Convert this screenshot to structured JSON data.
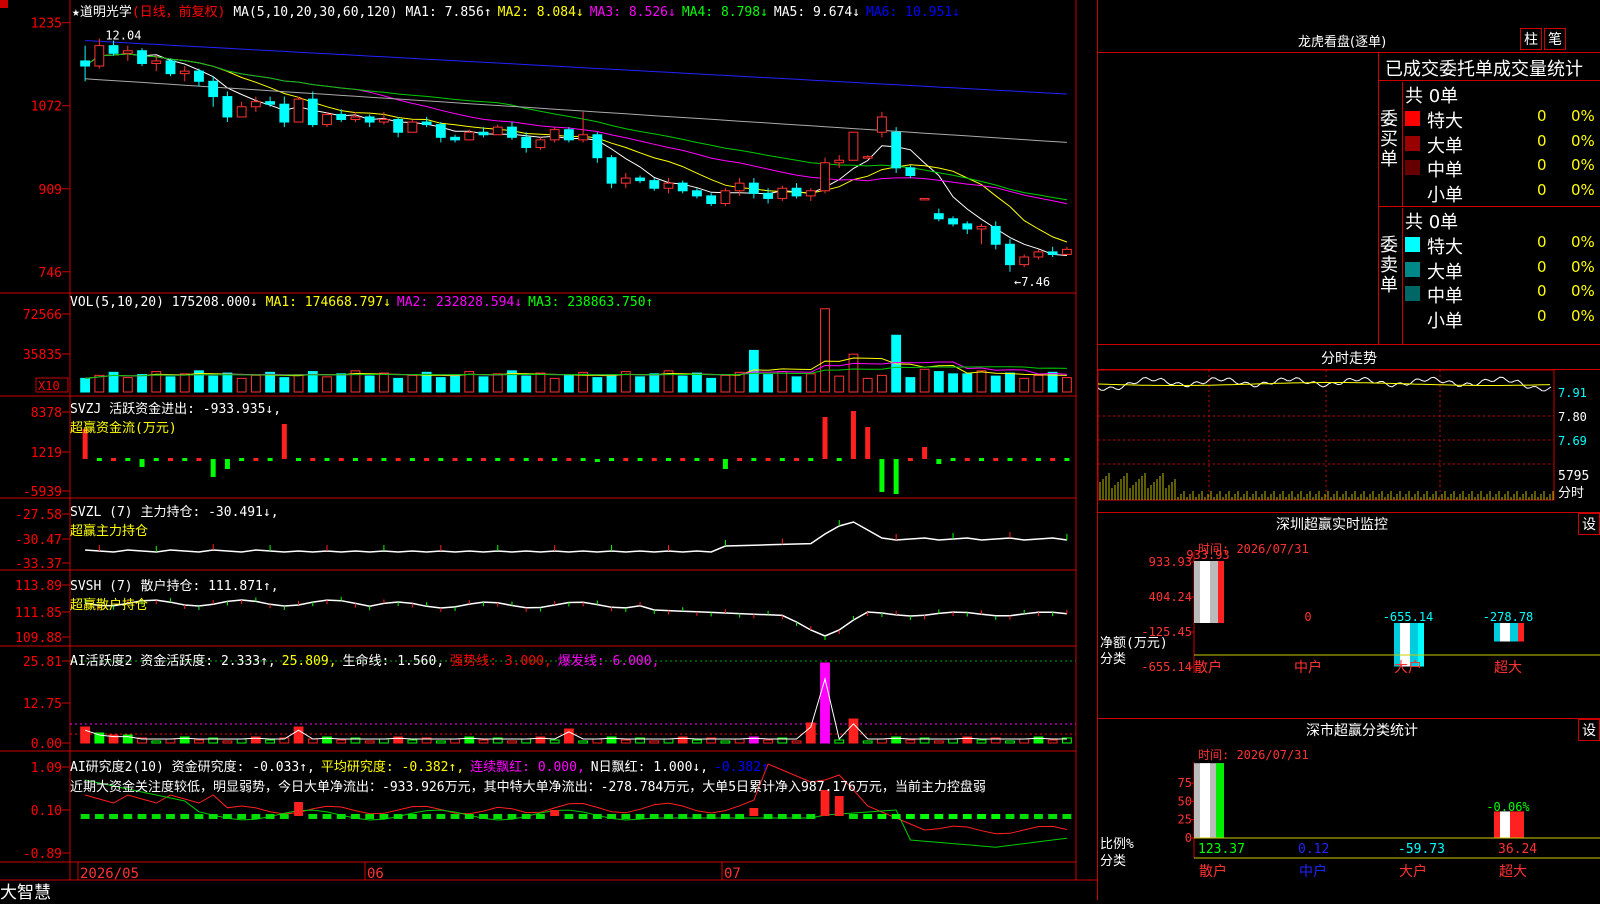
{
  "app_name": "大智慧",
  "stock": {
    "star": "★",
    "name": "道明光学",
    "period": "(日线，前复权)"
  },
  "ma_line": {
    "label": "MA(5,10,20,30,60,120)",
    "items": [
      {
        "text": "MA1: 7.856↑",
        "color": "#ffffff"
      },
      {
        "text": "MA2: 8.084↓",
        "color": "#ffff00"
      },
      {
        "text": "MA3: 8.526↓",
        "color": "#ff00ff"
      },
      {
        "text": "MA4: 8.798↓",
        "color": "#00ff00"
      },
      {
        "text": "MA5: 9.674↓",
        "color": "#ffffff"
      },
      {
        "text": "MA6: 10.951↓",
        "color": "#0000ff"
      }
    ]
  },
  "price_axis": [
    "1235",
    "1072",
    "909",
    "746"
  ],
  "price_marks": {
    "high": "12.04",
    "low": "←7.46"
  },
  "vol_line": {
    "label": "VOL(5,10,20)",
    "value": "175208.000↓",
    "items": [
      {
        "text": "MA1: 174668.797↓",
        "color": "#ffff00"
      },
      {
        "text": "MA2: 232828.594↓",
        "color": "#ff00ff"
      },
      {
        "text": "MA3: 238863.750↑",
        "color": "#00ff00"
      }
    ]
  },
  "vol_axis": [
    "72566",
    "35835"
  ],
  "vol_unit": "X10",
  "svzj": {
    "label": "SVZJ  活跃资金进出: -933.935↓,",
    "sub": "超赢资金流(万元)",
    "axis": [
      "8378",
      "1219",
      "-5939"
    ]
  },
  "svzl": {
    "label": "SVZL (7) 主力持仓: -30.491↓,",
    "sub": "超赢主力持仓",
    "axis": [
      "-27.58",
      "-30.47",
      "-33.37"
    ]
  },
  "svsh": {
    "label": "SVSH (7) 散户持仓: 111.871↑,",
    "sub": "超赢散户持仓",
    "axis": [
      "113.89",
      "111.85",
      "109.88"
    ]
  },
  "ai1": {
    "items": [
      {
        "text": "AI活跃度2 资金活跃度: 2.333↑,",
        "color": "#ffffff"
      },
      {
        "text": "25.809,",
        "color": "#ffff00"
      },
      {
        "text": "生命线: 1.560,",
        "color": "#ffffff"
      },
      {
        "text": "强势线: 3.000,",
        "color": "#ff0000"
      },
      {
        "text": "爆发线: 6.000,",
        "color": "#ff00ff"
      }
    ],
    "axis": [
      "25.81",
      "12.75",
      "0.00"
    ]
  },
  "ai2": {
    "items": [
      {
        "text": "AI研究度2(10) 资金研究度: -0.033↑,",
        "color": "#ffffff"
      },
      {
        "text": "平均研究度: -0.382↑,",
        "color": "#ffff00"
      },
      {
        "text": "连续飘红: 0.000,",
        "color": "#ff00ff"
      },
      {
        "text": "N日飘红: 1.000↓,",
        "color": "#ffffff"
      },
      {
        "text": "-0.382↑",
        "color": "#0000ff"
      }
    ],
    "desc": "近期大资金关注度较低，明显弱势，今日大单净流出：-933.926万元，其中特大单净流出：-278.784万元，大单5日累计净入987.176万元，当前主力控盘弱",
    "axis": [
      "1.09",
      "0.10",
      "-0.89"
    ]
  },
  "date_axis": [
    "2026/05",
    "06",
    "07"
  ],
  "lhkp": {
    "title": "龙虎看盘(逐单)",
    "btn1": "柱",
    "btn2": "笔",
    "subtitle": "已成交委托单成交量统计",
    "buy": {
      "label": "委买单",
      "total": "共 0单",
      "rows": [
        {
          "name": "特大",
          "count": "0",
          "pct": "0%",
          "color": "#ff0000"
        },
        {
          "name": "大单",
          "count": "0",
          "pct": "0%",
          "color": "#990000"
        },
        {
          "name": "中单",
          "count": "0",
          "pct": "0%",
          "color": "#660000"
        },
        {
          "name": "小单",
          "count": "0",
          "pct": "0%",
          "color": ""
        }
      ]
    },
    "sell": {
      "label": "委卖单",
      "total": "共 0单",
      "rows": [
        {
          "name": "特大",
          "count": "0",
          "pct": "0%",
          "color": "#00ffff"
        },
        {
          "name": "大单",
          "count": "0",
          "pct": "0%",
          "color": "#008888"
        },
        {
          "name": "中单",
          "count": "0",
          "pct": "0%",
          "color": "#006666"
        },
        {
          "name": "小单",
          "count": "0",
          "pct": "0%",
          "color": ""
        }
      ]
    }
  },
  "fenshi": {
    "title": "分时走势",
    "axis": [
      "7.91",
      "7.80",
      "7.69"
    ],
    "vol_top": "5795",
    "vol_label": "分时"
  },
  "monitor1": {
    "title": "深圳超赢实时监控",
    "btn": "设",
    "time": "时间: 2026/07/31",
    "axis": [
      "933.93",
      "404.24",
      "-125.45",
      "-655.14"
    ],
    "ylabel": "净额(万元)",
    "xlabel": "分类",
    "categories": [
      "散户",
      "中户",
      "大户",
      "超大"
    ],
    "values": [
      933.93,
      0,
      -655.14,
      -278.78
    ],
    "value_labels": [
      "933.93",
      "0",
      "-655.14",
      "-278.78"
    ]
  },
  "monitor2": {
    "title": "深市超赢分类统计",
    "btn": "设",
    "time": "时间: 2026/07/31",
    "axis": [
      "75",
      "50",
      "25",
      "0"
    ],
    "ylabel": "比例%",
    "xlabel": "分类",
    "categories": [
      "散户",
      "中户",
      "大户",
      "超大"
    ],
    "values": [
      123.37,
      0.12,
      -59.73,
      36.24
    ],
    "value_labels": [
      "123.37",
      "0.12",
      "-59.73",
      "36.24"
    ],
    "extra_label": "-0.06%"
  },
  "chart_data": {
    "type": "candlestick",
    "title": "道明光学",
    "dates_shown": [
      "2026/05",
      "06",
      "07"
    ],
    "ylim": [
      7.46,
      12.04
    ],
    "note_high": 12.04,
    "note_low": 7.46,
    "candles": [
      [
        11.6,
        11.9,
        11.2,
        11.5
      ],
      [
        11.5,
        12.04,
        11.45,
        11.9
      ],
      [
        11.9,
        12.0,
        11.7,
        11.75
      ],
      [
        11.75,
        11.9,
        11.6,
        11.8
      ],
      [
        11.8,
        11.85,
        11.5,
        11.55
      ],
      [
        11.55,
        11.7,
        11.4,
        11.6
      ],
      [
        11.6,
        11.65,
        11.3,
        11.35
      ],
      [
        11.35,
        11.5,
        11.2,
        11.4
      ],
      [
        11.4,
        11.45,
        11.1,
        11.2
      ],
      [
        11.2,
        11.3,
        10.7,
        10.9
      ],
      [
        10.9,
        11.0,
        10.4,
        10.5
      ],
      [
        10.5,
        10.8,
        10.5,
        10.7
      ],
      [
        10.7,
        10.9,
        10.6,
        10.8
      ],
      [
        10.8,
        10.9,
        10.7,
        10.75
      ],
      [
        10.75,
        10.9,
        10.3,
        10.4
      ],
      [
        10.4,
        10.9,
        10.4,
        10.85
      ],
      [
        10.85,
        11.0,
        10.3,
        10.35
      ],
      [
        10.35,
        10.6,
        10.3,
        10.55
      ],
      [
        10.55,
        10.65,
        10.4,
        10.45
      ],
      [
        10.45,
        10.6,
        10.4,
        10.5
      ],
      [
        10.5,
        10.55,
        10.3,
        10.4
      ],
      [
        10.4,
        10.6,
        10.35,
        10.45
      ],
      [
        10.45,
        10.5,
        10.1,
        10.2
      ],
      [
        10.2,
        10.45,
        10.2,
        10.4
      ],
      [
        10.4,
        10.5,
        10.3,
        10.35
      ],
      [
        10.35,
        10.4,
        10.0,
        10.1
      ],
      [
        10.1,
        10.15,
        10.0,
        10.05
      ],
      [
        10.05,
        10.25,
        10.05,
        10.2
      ],
      [
        10.2,
        10.3,
        10.1,
        10.15
      ],
      [
        10.15,
        10.35,
        10.15,
        10.3
      ],
      [
        10.3,
        10.4,
        10.05,
        10.1
      ],
      [
        10.1,
        10.2,
        9.8,
        9.9
      ],
      [
        9.9,
        10.1,
        9.85,
        10.05
      ],
      [
        10.05,
        10.3,
        10.0,
        10.25
      ],
      [
        10.25,
        10.3,
        10.0,
        10.05
      ],
      [
        10.05,
        10.6,
        10.0,
        10.15
      ],
      [
        10.15,
        10.2,
        9.6,
        9.7
      ],
      [
        9.7,
        9.75,
        9.1,
        9.2
      ],
      [
        9.2,
        9.4,
        9.1,
        9.3
      ],
      [
        9.3,
        9.35,
        9.2,
        9.25
      ],
      [
        9.25,
        9.3,
        9.05,
        9.1
      ],
      [
        9.1,
        9.3,
        9.0,
        9.2
      ],
      [
        9.2,
        9.25,
        9.0,
        9.05
      ],
      [
        9.05,
        9.1,
        8.9,
        8.95
      ],
      [
        8.95,
        9.0,
        8.75,
        8.8
      ],
      [
        8.8,
        9.1,
        8.75,
        9.05
      ],
      [
        9.05,
        9.3,
        8.95,
        9.2
      ],
      [
        9.2,
        9.3,
        8.9,
        9.0
      ],
      [
        9.0,
        9.1,
        8.8,
        8.9
      ],
      [
        8.9,
        9.15,
        8.85,
        9.1
      ],
      [
        9.1,
        9.2,
        8.9,
        8.95
      ],
      [
        8.95,
        9.1,
        8.85,
        9.05
      ],
      [
        9.05,
        9.7,
        9.0,
        9.6
      ],
      [
        9.6,
        9.75,
        9.5,
        9.65
      ],
      [
        9.65,
        10.2,
        10.2,
        10.2
      ],
      [
        9.7,
        9.75,
        9.7,
        9.72
      ],
      [
        10.2,
        10.6,
        10.1,
        10.5
      ],
      [
        10.2,
        10.3,
        9.4,
        9.5
      ],
      [
        9.5,
        9.55,
        9.3,
        9.35
      ],
      [
        8.9,
        8.9,
        8.9,
        8.9
      ],
      [
        8.6,
        8.7,
        8.45,
        8.5
      ],
      [
        8.5,
        8.55,
        8.35,
        8.4
      ],
      [
        8.4,
        8.45,
        8.2,
        8.3
      ],
      [
        8.3,
        8.4,
        8.0,
        8.35
      ],
      [
        8.35,
        8.45,
        7.9,
        8.0
      ],
      [
        8.0,
        8.1,
        7.46,
        7.6
      ],
      [
        7.6,
        7.8,
        7.55,
        7.75
      ],
      [
        7.75,
        7.9,
        7.7,
        7.85
      ],
      [
        7.85,
        7.95,
        7.75,
        7.8
      ],
      [
        7.8,
        7.95,
        7.8,
        7.9
      ]
    ]
  }
}
